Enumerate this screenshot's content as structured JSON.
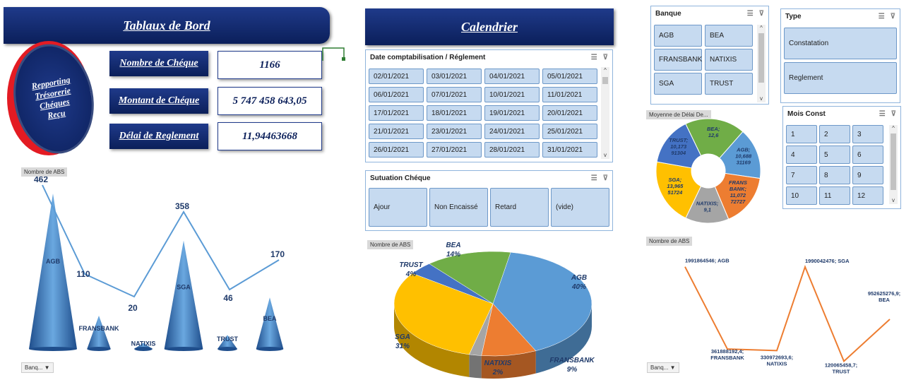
{
  "header": {
    "title": "Tablaux de Bord",
    "calendar_title": "Calendrier"
  },
  "badge": {
    "line1": "Repporting",
    "line2": "Trésorerie",
    "line3": "Chéques",
    "line4": "Reçu"
  },
  "kpis": [
    {
      "label": "Nombre de Chéque",
      "value": "1166"
    },
    {
      "label": "Montant de Chéque",
      "value": "5 747 458 643,05"
    },
    {
      "label": "Délai de Reglement",
      "value": "11,94463668"
    }
  ],
  "date_slicer": {
    "title": "Date comptabilisation / Réglement",
    "dates": [
      "02/01/2021",
      "03/01/2021",
      "04/01/2021",
      "05/01/2021",
      "06/01/2021",
      "07/01/2021",
      "10/01/2021",
      "11/01/2021",
      "17/01/2021",
      "18/01/2021",
      "19/01/2021",
      "20/01/2021",
      "21/01/2021",
      "23/01/2021",
      "24/01/2021",
      "25/01/2021",
      "26/01/2021",
      "27/01/2021",
      "28/01/2021",
      "31/01/2021"
    ]
  },
  "situation_slicer": {
    "title": "Sutuation Chéque",
    "items": [
      "Ajour",
      "Non Encaissé",
      "Retard",
      "(vide)"
    ]
  },
  "banque_slicer": {
    "title": "Banque",
    "items": [
      "AGB",
      "BEA",
      "FRANSBANK",
      "NATIXIS",
      "SGA",
      "TRUST"
    ]
  },
  "type_slicer": {
    "title": "Type",
    "items": [
      "Constatation",
      "Reglement"
    ]
  },
  "mois_slicer": {
    "title": "Mois Const",
    "items": [
      "1",
      "2",
      "3",
      "4",
      "5",
      "6",
      "7",
      "8",
      "9",
      "10",
      "11",
      "12"
    ]
  },
  "icons": {
    "multi_select": "multi-select-icon",
    "clear_filter": "clear-filter-icon"
  },
  "cone_chart": {
    "tag": "Nombre de ABS",
    "filter": "Banq...",
    "chart_data": {
      "type": "bar",
      "categories": [
        "AGB",
        "FRANSBANK",
        "NATIXIS",
        "SGA",
        "TRUST",
        "BEA"
      ],
      "values": [
        462,
        110,
        20,
        358,
        46,
        170
      ],
      "labels": [
        "462",
        "110",
        "20",
        "358",
        "46",
        "170"
      ]
    }
  },
  "pie_chart": {
    "tag": "Nombre de ABS",
    "chart_data": {
      "type": "pie",
      "slices": [
        {
          "name": "AGB",
          "pct": "40%",
          "value": 40,
          "color": "#5b9bd5"
        },
        {
          "name": "FRANSBANK",
          "pct": "9%",
          "value": 9,
          "color": "#ed7d31"
        },
        {
          "name": "NATIXIS",
          "pct": "2%",
          "value": 2,
          "color": "#a5a5a5"
        },
        {
          "name": "SGA",
          "pct": "31%",
          "value": 31,
          "color": "#ffc000"
        },
        {
          "name": "TRUST",
          "pct": "4%",
          "value": 4,
          "color": "#4472c4"
        },
        {
          "name": "BEA",
          "pct": "14%",
          "value": 14,
          "color": "#70ad47"
        }
      ]
    }
  },
  "donut_chart": {
    "tag": "Moyenne de Délai De...",
    "chart_data": {
      "type": "pie",
      "slices": [
        {
          "label": "BEA;\n12,6",
          "value": 12.6,
          "color": "#70ad47"
        },
        {
          "label": "AGB;\n10,688\n31169",
          "value": 10.688,
          "color": "#5b9bd5"
        },
        {
          "label": "FRANS\nBANK;\n11,072\n72727",
          "value": 11.072,
          "color": "#ed7d31"
        },
        {
          "label": "NATIXIS;\n9,1",
          "value": 9.1,
          "color": "#a5a5a5"
        },
        {
          "label": "SGA;\n13,965\n51724",
          "value": 13.965,
          "color": "#ffc000"
        },
        {
          "label": "TRUST;\n10,173\n91304",
          "value": 10.173,
          "color": "#4472c4"
        }
      ]
    }
  },
  "line_chart": {
    "tag": "Nombre de ABS",
    "filter": "Banq...",
    "chart_data": {
      "type": "line",
      "categories": [
        "AGB",
        "FRANSBANK",
        "NATIXIS",
        "SGA",
        "TRUST",
        "BEA"
      ],
      "values": [
        1991864546,
        361888192.4,
        330972693.6,
        1990042476,
        120065458.7,
        952625276.9
      ],
      "labels": [
        "1991864546; AGB",
        "361888192,4;\nFRANSBANK",
        "330972693,6;\nNATIXIS",
        "1990042476; SGA",
        "120065458,7;\nTRUST",
        "952625276,9;\nBEA"
      ]
    }
  }
}
